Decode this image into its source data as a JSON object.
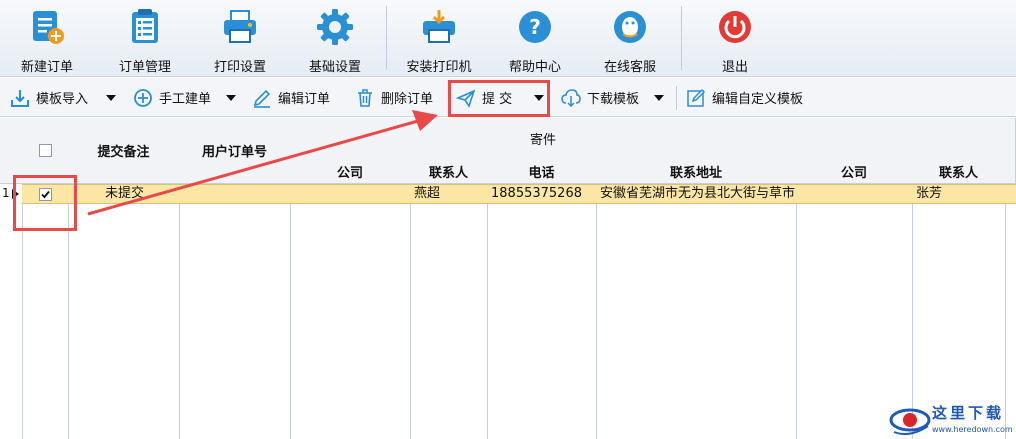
{
  "ribbon": {
    "items": [
      {
        "label": "新建订单",
        "icon": "new-order-icon"
      },
      {
        "label": "订单管理",
        "icon": "clipboard-icon"
      },
      {
        "label": "打印设置",
        "icon": "printer-icon"
      },
      {
        "label": "基础设置",
        "icon": "gear-icon"
      },
      {
        "label": "安装打印机",
        "icon": "install-printer-icon"
      },
      {
        "label": "帮助中心",
        "icon": "help-icon"
      },
      {
        "label": "在线客服",
        "icon": "qq-penguin-icon"
      },
      {
        "label": "退出",
        "icon": "power-icon"
      }
    ]
  },
  "toolbar": {
    "import": "模板导入",
    "manual": "手工建单",
    "edit": "编辑订单",
    "delete": "删除订单",
    "submit": "提 交",
    "download": "下载模板",
    "edit_template": "编辑自定义模板"
  },
  "grid": {
    "headers": {
      "remark": "提交备注",
      "user_order": "用户订单号",
      "sender_group": "寄件",
      "company": "公司",
      "contact": "联系人",
      "phone": "电话",
      "address": "联系地址",
      "company2": "公司",
      "contact2": "联系人"
    },
    "rows": [
      {
        "index": "1",
        "checked": true,
        "remark": "未提交",
        "user_order": "",
        "company": "",
        "contact": "燕超",
        "phone": "18855375268",
        "address": "安徽省芜湖市无为县北大街与草市",
        "company2": "",
        "contact2": "张芳"
      }
    ]
  },
  "watermark": {
    "text": "这里下载",
    "url": "www.heredown.com"
  },
  "colors": {
    "accent": "#2b8fd6",
    "highlight": "#fbe6a5",
    "annotation": "#e84a4a"
  }
}
